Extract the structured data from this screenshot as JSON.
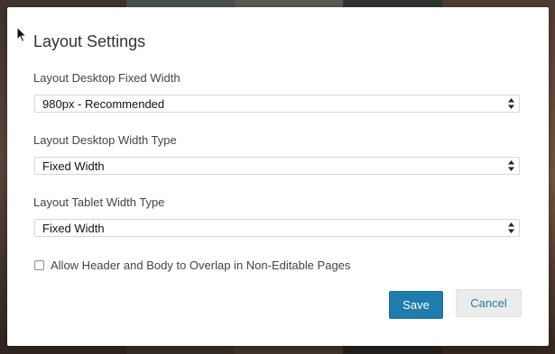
{
  "dialog": {
    "title": "Layout Settings"
  },
  "fields": [
    {
      "label": "Layout Desktop Fixed Width",
      "value": "980px - Recommended"
    },
    {
      "label": "Layout Desktop Width Type",
      "value": "Fixed Width"
    },
    {
      "label": "Layout Tablet Width Type",
      "value": "Fixed Width"
    }
  ],
  "overlap_checkbox": {
    "label": "Allow Header and Body to Overlap in Non-Editable Pages",
    "checked": false
  },
  "buttons": {
    "save_label": "Save",
    "cancel_label": "Cancel"
  },
  "colors": {
    "primary": "#1f7cac",
    "secondary_bg": "#ececec"
  },
  "icons": {
    "select_arrows": "updown-arrows-icon",
    "cursor": "mouse-pointer-icon"
  }
}
